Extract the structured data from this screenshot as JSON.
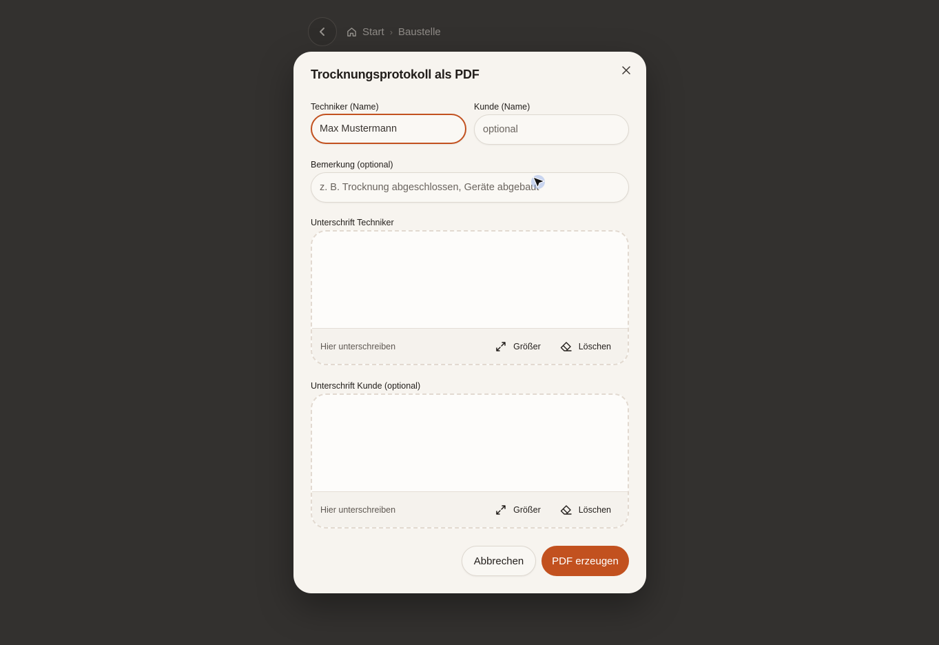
{
  "background_nav": {
    "back_icon": "chevron-left-icon",
    "home_icon": "home-icon",
    "breadcrumb": [
      "Start",
      "Baustelle"
    ]
  },
  "modal": {
    "title": "Trocknungsprotokoll als PDF",
    "close_icon": "close-icon",
    "fields": {
      "techniker": {
        "label": "Techniker (Name)",
        "value": "Max Mustermann",
        "placeholder": ""
      },
      "kunde": {
        "label": "Kunde (Name)",
        "value": "",
        "placeholder": "optional"
      },
      "bemerkung": {
        "label": "Bemerkung (optional)",
        "value": "",
        "placeholder": "z. B. Trocknung abgeschlossen, Geräte abgebaut"
      }
    },
    "signatures": [
      {
        "label": "Unterschrift Techniker",
        "hint": "Hier unterschreiben",
        "enlarge": "Größer",
        "clear": "Löschen"
      },
      {
        "label": "Unterschrift Kunde (optional)",
        "hint": "Hier unterschreiben",
        "enlarge": "Größer",
        "clear": "Löschen"
      }
    ],
    "buttons": {
      "cancel": "Abbrechen",
      "submit": "PDF erzeugen"
    }
  },
  "colors": {
    "accent": "#c2511f",
    "modal_bg": "#f7f4ef",
    "page_bg": "#33312f"
  }
}
